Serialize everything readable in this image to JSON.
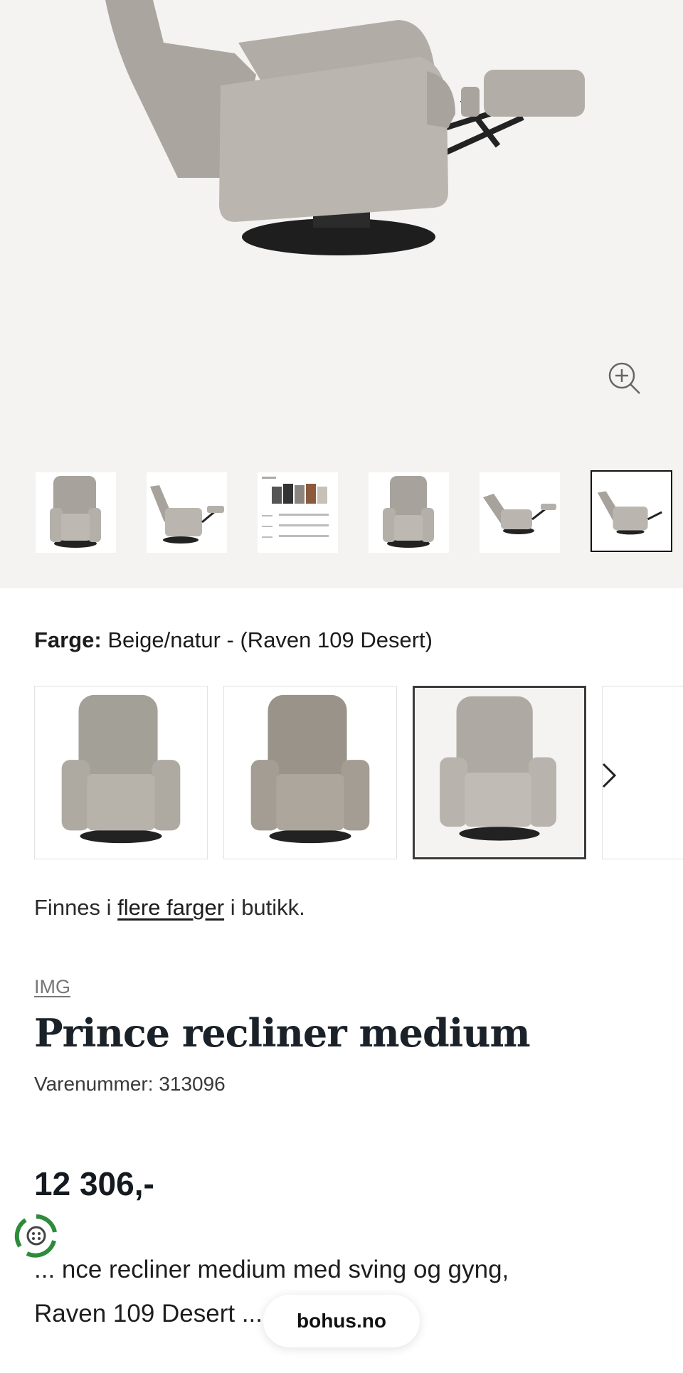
{
  "gallery": {
    "hero_image": "recliner-reclined-side-view",
    "zoom_icon": "zoom-in-icon",
    "thumbnails": [
      {
        "image": "recliner-front"
      },
      {
        "image": "recliner-reclined"
      },
      {
        "image": "color-chart"
      },
      {
        "image": "recliner-front"
      },
      {
        "image": "recliner-reclined-low"
      },
      {
        "image": "recliner-reclined-side",
        "active": true
      }
    ]
  },
  "variant": {
    "label": "Farge:",
    "value": "Beige/natur - (Raven 109 Desert)",
    "swatches": [
      {
        "color": "#a9a49c"
      },
      {
        "color": "#9e978d"
      },
      {
        "color": "#b3afa8",
        "active": true
      }
    ],
    "next_icon": "chevron-right-icon"
  },
  "availability": {
    "prefix": "Finnes i ",
    "link": "flere farger",
    "suffix": " i butikk."
  },
  "product": {
    "brand": "IMG",
    "title": "Prince recliner medium",
    "sku": "Varenummer: 313096",
    "price": "12 306,-",
    "description_line1": "... nce recliner medium med sving og gyng,",
    "description_line2": "Raven 109 Desert ..."
  },
  "floating": {
    "site_label": "bohus.no",
    "badge_icon": "circular-economy-icon"
  }
}
